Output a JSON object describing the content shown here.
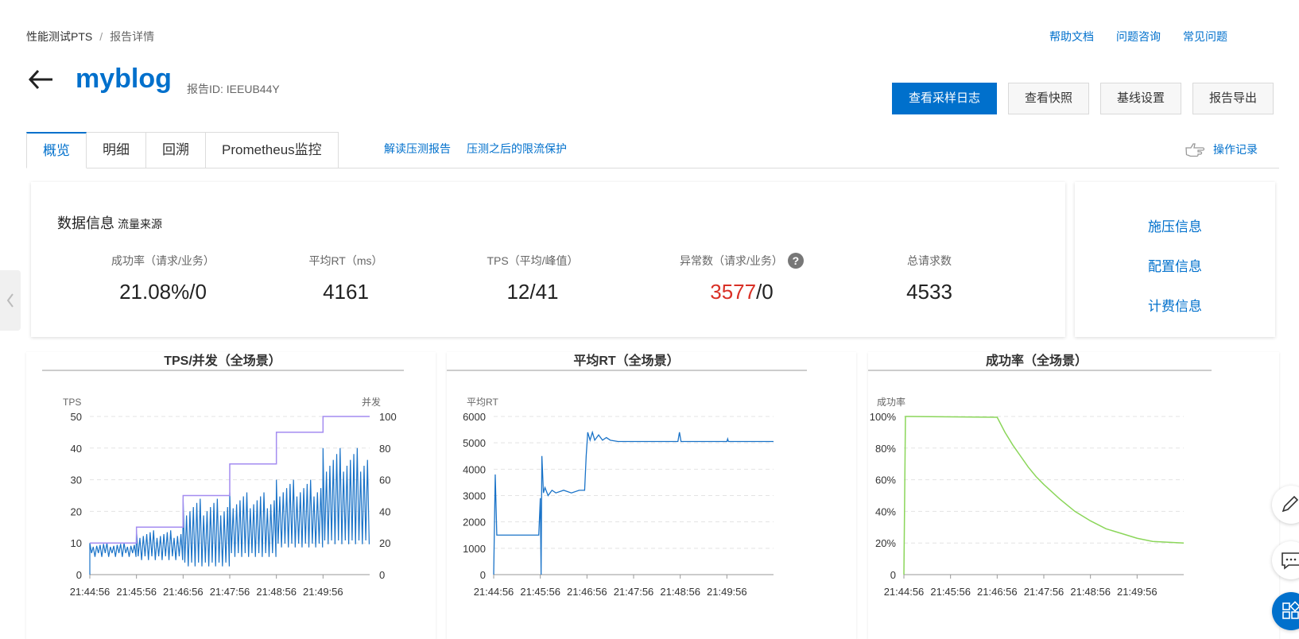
{
  "breadcrumb": {
    "root": "性能测试PTS",
    "separator": "/",
    "current": "报告详情"
  },
  "top_links": [
    "帮助文档",
    "问题咨询",
    "常见问题"
  ],
  "header": {
    "title": "myblog",
    "report_id": "报告ID:  IEEUB44Y"
  },
  "buttons": {
    "sample_log": "查看采样日志",
    "snapshot": "查看快照",
    "baseline": "基线设置",
    "export": "报告导出"
  },
  "tabs": [
    "概览",
    "明细",
    "回溯",
    "Prometheus监控"
  ],
  "tab_links": [
    "解读压测报告",
    "压测之后的限流保护"
  ],
  "operation_log": "操作记录",
  "data_info": {
    "title": "数据信息",
    "subtitle": "流量来源",
    "metrics": [
      {
        "label": "成功率（请求/业务）",
        "value": "21.08%/0"
      },
      {
        "label": "平均RT（ms）",
        "value": "4161"
      },
      {
        "label": "TPS（平均/峰值）",
        "value": "12/41"
      },
      {
        "label": "异常数（请求/业务）",
        "value_red": "3577",
        "value_rest": "/0",
        "help": "?"
      },
      {
        "label": "总请求数",
        "value": "4533"
      }
    ]
  },
  "side_links": [
    "施压信息",
    "配置信息",
    "计费信息"
  ],
  "colors": {
    "accent": "#0070cc",
    "tps_line": "#1a73c8",
    "concurrency_line": "#a48cf0",
    "success_line": "#8bd65a",
    "error_red": "#d93026"
  },
  "chart_data": [
    {
      "type": "line",
      "title": "TPS/并发（全场景）",
      "ylabel": "TPS",
      "y2label": "并发",
      "x_ticks": [
        "21:44:56",
        "21:45:56",
        "21:46:56",
        "21:47:56",
        "21:48:56",
        "21:49:56"
      ],
      "ylim": [
        0,
        50
      ],
      "y_ticks": [
        0,
        10,
        20,
        30,
        40,
        50
      ],
      "y2lim": [
        0,
        100
      ],
      "y2_ticks": [
        0,
        20,
        40,
        60,
        80,
        100
      ],
      "series": [
        {
          "values_desc": "TPS oscillating, increasing amplitude per step",
          "steps": [
            {
              "t_start": 0,
              "t_end": 60,
              "low": 5,
              "high": 10
            },
            {
              "t_start": 60,
              "t_end": 120,
              "low": 4,
              "high": 14
            },
            {
              "t_start": 120,
              "t_end": 180,
              "low": 2,
              "high": 24
            },
            {
              "t_start": 180,
              "t_end": 240,
              "low": 5,
              "high": 26
            },
            {
              "t_start": 240,
              "t_end": 300,
              "low": 8,
              "high": 30
            },
            {
              "t_start": 300,
              "t_end": 360,
              "low": 9,
              "high": 40
            }
          ]
        },
        {
          "values_desc": "concurrency steps",
          "points": [
            [
              0,
              20
            ],
            [
              60,
              20
            ],
            [
              60,
              30
            ],
            [
              120,
              30
            ],
            [
              120,
              50
            ],
            [
              180,
              50
            ],
            [
              180,
              70
            ],
            [
              240,
              70
            ],
            [
              240,
              90
            ],
            [
              300,
              90
            ],
            [
              300,
              100
            ],
            [
              360,
              100
            ]
          ]
        }
      ]
    },
    {
      "type": "line",
      "title": "平均RT（全场景）",
      "ylabel": "平均RT",
      "x_ticks": [
        "21:44:56",
        "21:45:56",
        "21:46:56",
        "21:47:56",
        "21:48:56",
        "21:49:56"
      ],
      "ylim": [
        0,
        6000
      ],
      "y_ticks": [
        0,
        1000,
        2000,
        3000,
        4000,
        5000,
        6000
      ],
      "points": [
        [
          0,
          0
        ],
        [
          2,
          3800
        ],
        [
          4,
          1500
        ],
        [
          58,
          1500
        ],
        [
          60,
          2900
        ],
        [
          61,
          0
        ],
        [
          62,
          4500
        ],
        [
          64,
          3100
        ],
        [
          66,
          3300
        ],
        [
          70,
          3000
        ],
        [
          75,
          3200
        ],
        [
          80,
          3100
        ],
        [
          90,
          3200
        ],
        [
          100,
          3100
        ],
        [
          110,
          3200
        ],
        [
          117,
          3200
        ],
        [
          119,
          4500
        ],
        [
          121,
          5400
        ],
        [
          124,
          5100
        ],
        [
          127,
          5400
        ],
        [
          130,
          5100
        ],
        [
          135,
          5300
        ],
        [
          140,
          5100
        ],
        [
          145,
          5200
        ],
        [
          150,
          5100
        ],
        [
          160,
          5050
        ],
        [
          237,
          5050
        ],
        [
          239,
          5400
        ],
        [
          241,
          5050
        ],
        [
          300,
          5050
        ],
        [
          301,
          5150
        ],
        [
          302,
          5050
        ],
        [
          360,
          5050
        ]
      ]
    },
    {
      "type": "line",
      "title": "成功率（全场景）",
      "ylabel": "成功率",
      "x_ticks": [
        "21:44:56",
        "21:45:56",
        "21:46:56",
        "21:47:56",
        "21:48:56",
        "21:49:56"
      ],
      "ylim": [
        0,
        100
      ],
      "y_ticks": [
        "0",
        "20%",
        "40%",
        "60%",
        "80%",
        "100%"
      ],
      "points": [
        [
          0,
          0
        ],
        [
          2,
          100
        ],
        [
          120,
          99.5
        ],
        [
          130,
          90
        ],
        [
          140,
          82
        ],
        [
          150,
          75
        ],
        [
          160,
          68
        ],
        [
          170,
          62
        ],
        [
          180,
          57
        ],
        [
          200,
          48
        ],
        [
          220,
          40
        ],
        [
          240,
          34
        ],
        [
          260,
          29
        ],
        [
          280,
          26
        ],
        [
          300,
          23
        ],
        [
          320,
          21
        ],
        [
          360,
          20
        ]
      ]
    }
  ]
}
